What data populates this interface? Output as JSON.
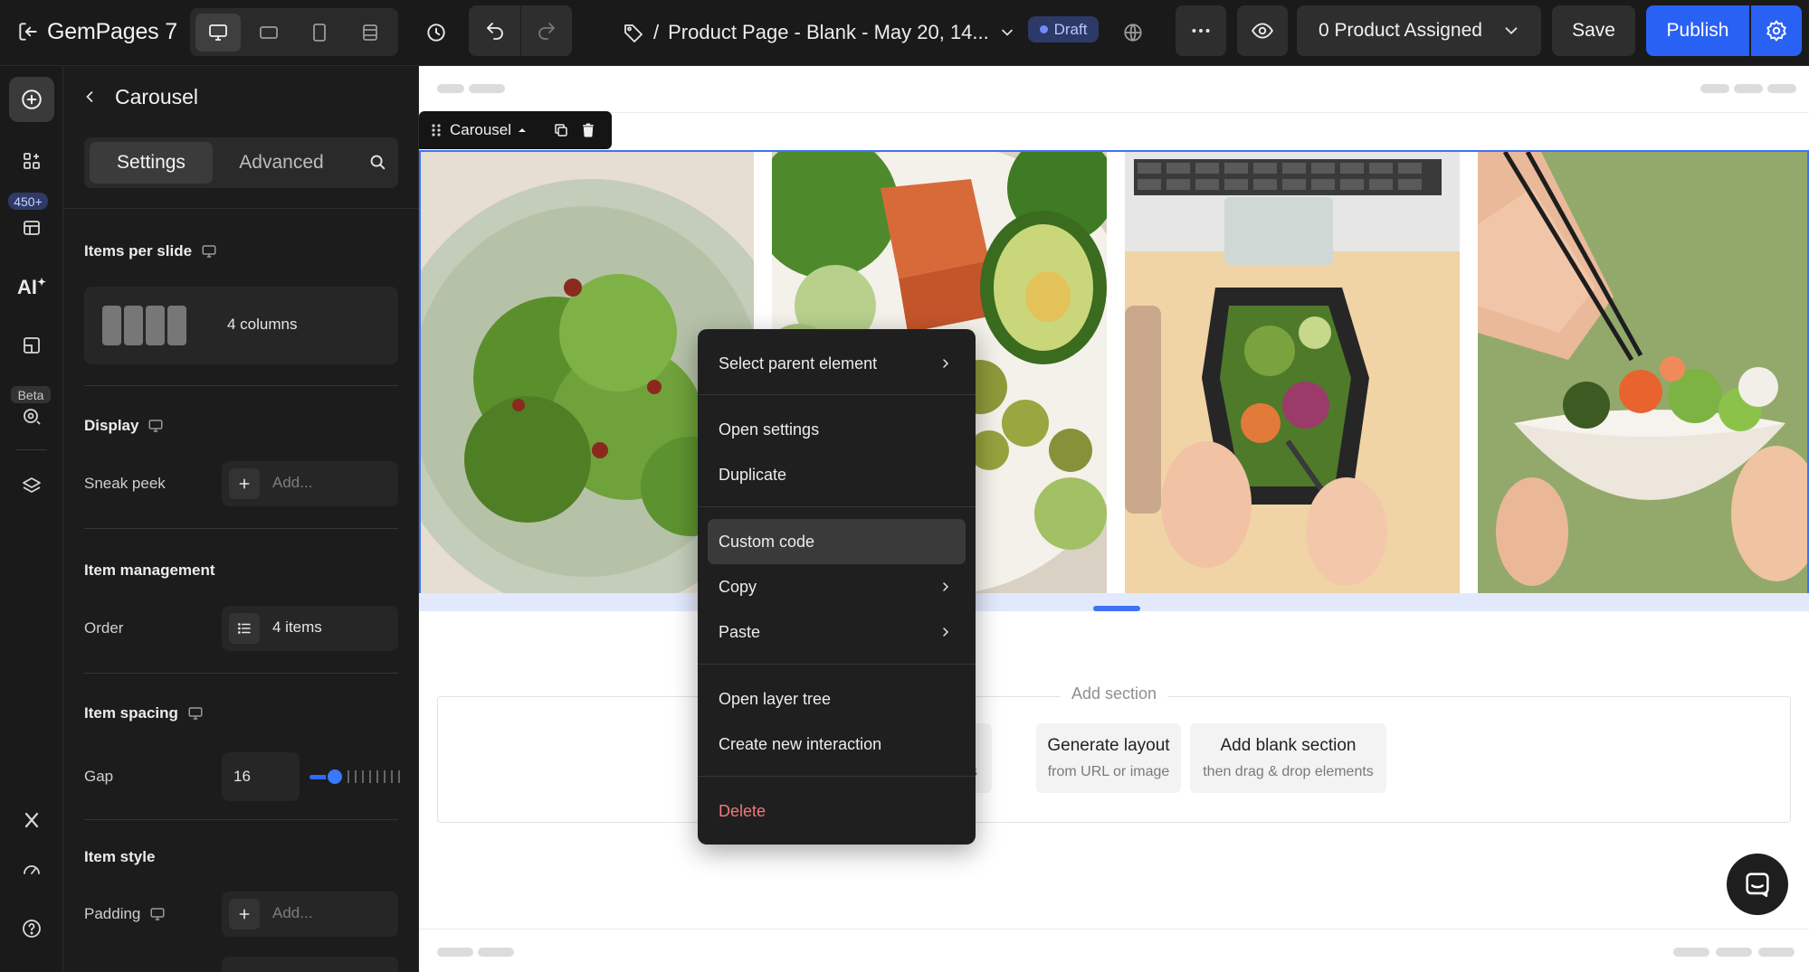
{
  "topbar": {
    "logo_text": "GemPages",
    "logo_version": "7",
    "page_prefix": "/",
    "page_name": "Product Page - Blank - May 20, 14...",
    "status_badge": "Draft",
    "assign_label": "0 Product Assigned",
    "save_label": "Save",
    "publish_label": "Publish",
    "icons": [
      "exit-icon",
      "desktop-icon",
      "tablet-landscape-icon",
      "tablet-icon",
      "mobile-icon",
      "history-icon",
      "undo-icon",
      "redo-icon",
      "tag-icon",
      "chevron-down-icon",
      "globe-icon",
      "more-icon",
      "eye-icon",
      "gear-icon"
    ]
  },
  "rail": {
    "badge": "450+",
    "beta": "Beta",
    "icons": [
      "add-icon",
      "elements-icon",
      "templates-icon",
      "ai-icon",
      "pages-icon",
      "ai-tool-icon",
      "layers-icon",
      "x-icon",
      "speed-icon",
      "help-icon"
    ],
    "ai_label": "AI"
  },
  "panel": {
    "title": "Carousel",
    "tabs": [
      "Settings",
      "Advanced"
    ],
    "items_per_slide": {
      "label": "Items per slide",
      "value": "4 columns"
    },
    "display": {
      "label": "Display",
      "sneak_peek_label": "Sneak peek",
      "sneak_peek_placeholder": "Add..."
    },
    "item_management": {
      "label": "Item management",
      "order_label": "Order",
      "order_value": "4 items"
    },
    "item_spacing": {
      "label": "Item spacing",
      "gap_label": "Gap",
      "gap_value": "16",
      "gap_slider_fraction": 0.16
    },
    "item_style": {
      "label": "Item style",
      "padding_label": "Padding",
      "padding_placeholder": "Add..."
    }
  },
  "canvas": {
    "selected_element": "Carousel",
    "slides": [
      {
        "name": "salad-bowl-image"
      },
      {
        "name": "salmon-avocado-salad-image"
      },
      {
        "name": "lunch-box-laptop-image"
      },
      {
        "name": "poke-bowl-chopsticks-image"
      }
    ],
    "add_section": {
      "title": "Add section",
      "cards": [
        {
          "title": "ates",
          "subtitle": "perts"
        },
        {
          "title": "Generate layout",
          "subtitle": "from URL or image"
        },
        {
          "title": "Add blank section",
          "subtitle": "then drag & drop elements"
        }
      ]
    }
  },
  "context_menu": {
    "items": [
      {
        "label": "Select parent element",
        "submenu": true
      },
      {
        "label": "Open settings",
        "submenu": false
      },
      {
        "label": "Duplicate",
        "submenu": false
      },
      {
        "label": "Custom code",
        "submenu": false,
        "hovered": true
      },
      {
        "label": "Copy",
        "submenu": true
      },
      {
        "label": "Paste",
        "submenu": true
      },
      {
        "label": "Open layer tree",
        "submenu": false
      },
      {
        "label": "Create new interaction",
        "submenu": false
      },
      {
        "label": "Delete",
        "submenu": false,
        "danger": true
      }
    ]
  },
  "colors": {
    "accent": "#2a61f5",
    "selection": "#3f72f5",
    "danger": "#f27878",
    "topbar_bg": "#1a1a1a"
  }
}
